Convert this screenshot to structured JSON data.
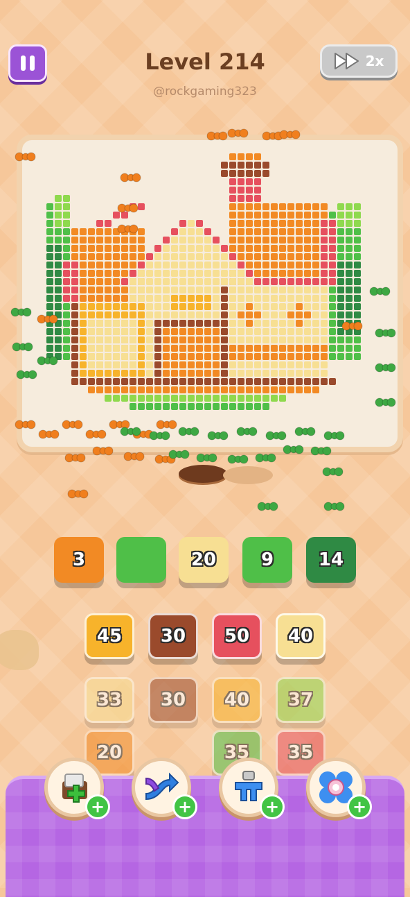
{
  "header": {
    "level_title": "Level 214",
    "username": "@rockgaming323",
    "speed_label": "2x"
  },
  "icons": {
    "pause": "pause-icon",
    "fast_forward": "fast-forward-icon",
    "boosters": [
      "add-box-icon",
      "shuffle-icon",
      "magnet-claw-icon",
      "flower-icon"
    ]
  },
  "colors": {
    "orange": "#f28a24",
    "green": "#4fbf48",
    "dark_green": "#2f8a44",
    "cream": "#f7df93",
    "brown": "#9a4a2c",
    "red": "#e6505e",
    "yellow": "#f7b32b",
    "lime": "#8fd94e",
    "tray": "#b566e3"
  },
  "conveyor": [
    {
      "value": "3",
      "color": "orange"
    },
    {
      "value": "",
      "color": "green"
    },
    {
      "value": "20",
      "color": "cream"
    },
    {
      "value": "9",
      "color": "green"
    },
    {
      "value": "14",
      "color": "dark_green"
    }
  ],
  "stacks": [
    [
      {
        "value": "45",
        "color": "yellow"
      },
      {
        "value": "33",
        "color": "cream"
      },
      {
        "value": "20",
        "color": "orange"
      }
    ],
    [
      {
        "value": "30",
        "color": "brown"
      },
      {
        "value": "30",
        "color": "brown"
      }
    ],
    [
      {
        "value": "50",
        "color": "red"
      },
      {
        "value": "40",
        "color": "yellow"
      },
      {
        "value": "35",
        "color": "green"
      }
    ],
    [
      {
        "value": "40",
        "color": "cream"
      },
      {
        "value": "37",
        "color": "lime"
      },
      {
        "value": "35",
        "color": "red"
      }
    ]
  ]
}
